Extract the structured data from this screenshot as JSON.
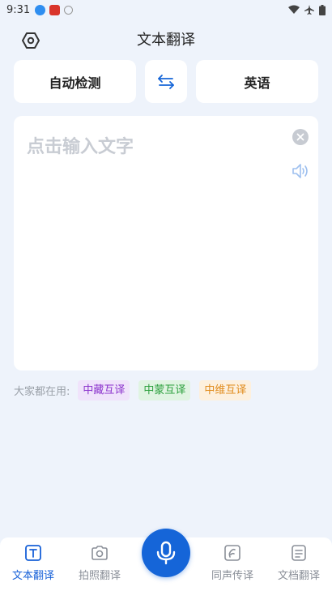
{
  "status_bar": {
    "time": "9:31"
  },
  "header": {
    "title": "文本翻译"
  },
  "lang": {
    "source": "自动检测",
    "target": "英语"
  },
  "input": {
    "placeholder": "点击输入文字"
  },
  "quick": {
    "label": "大家都在用:",
    "chips": [
      "中藏互译",
      "中蒙互译",
      "中维互译"
    ]
  },
  "nav": {
    "items": [
      {
        "label": "文本翻译",
        "icon": "text-translate-icon"
      },
      {
        "label": "拍照翻译",
        "icon": "camera-icon"
      },
      {
        "label": "同声传译",
        "icon": "simultaneous-icon"
      },
      {
        "label": "文档翻译",
        "icon": "document-icon"
      }
    ]
  },
  "colors": {
    "accent": "#1565d8",
    "background": "#eef3fb",
    "chip_tibetan": "#8a32cc",
    "chip_mongol": "#2b9f3d",
    "chip_uyghur": "#e08a1a"
  }
}
